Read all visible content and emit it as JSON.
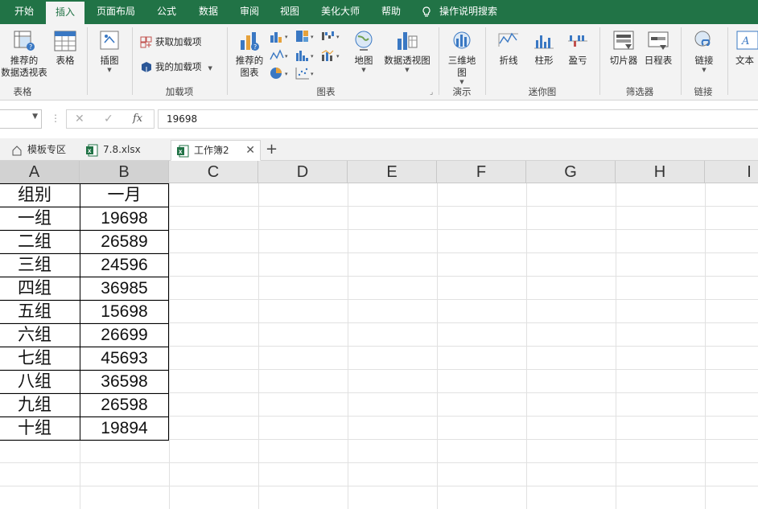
{
  "ribbon_tabs": [
    {
      "label": "开始"
    },
    {
      "label": "插入"
    },
    {
      "label": "页面布局"
    },
    {
      "label": "公式"
    },
    {
      "label": "数据"
    },
    {
      "label": "审阅"
    },
    {
      "label": "视图"
    },
    {
      "label": "美化大师"
    },
    {
      "label": "帮助"
    }
  ],
  "tell_me": "操作说明搜索",
  "ribbon": {
    "groups": {
      "tables": "表格",
      "addins": "加载项",
      "charts": "图表",
      "tours": "演示",
      "sparklines": "迷你图",
      "filters": "筛选器",
      "links": "链接"
    },
    "buttons": {
      "recommended_pivot_1": "推荐的",
      "recommended_pivot_2": "数据透视表",
      "table": "表格",
      "illustrations": "插图",
      "get_addins": "获取加载项",
      "my_addins": "我的加载项",
      "recommended_charts_1": "推荐的",
      "recommended_charts_2": "图表",
      "maps": "地图",
      "pivot_chart": "数据透视图",
      "map3d_1": "三维地",
      "map3d_2": "图",
      "line": "折线",
      "column": "柱形",
      "winloss": "盈亏",
      "slicer": "切片器",
      "timeline": "日程表",
      "link": "链接",
      "text": "文本"
    }
  },
  "formula_bar": {
    "value": "19698",
    "fx": "fx"
  },
  "doc_tabs": [
    {
      "label": "模板专区"
    },
    {
      "label": "7.8.xlsx"
    },
    {
      "label": "工作簿2"
    }
  ],
  "columns": [
    "A",
    "B",
    "C",
    "D",
    "E",
    "F",
    "G",
    "H",
    "I"
  ],
  "table": {
    "headers": [
      "组别",
      "一月"
    ],
    "rows": [
      {
        "group": "一组",
        "jan": "19698"
      },
      {
        "group": "二组",
        "jan": "26589"
      },
      {
        "group": "三组",
        "jan": "24596"
      },
      {
        "group": "四组",
        "jan": "36985"
      },
      {
        "group": "五组",
        "jan": "15698"
      },
      {
        "group": "六组",
        "jan": "26699"
      },
      {
        "group": "七组",
        "jan": "45693"
      },
      {
        "group": "八组",
        "jan": "36598"
      },
      {
        "group": "九组",
        "jan": "26598"
      },
      {
        "group": "十组",
        "jan": "19894"
      }
    ]
  },
  "colors": {
    "excel_green": "#217346",
    "ribbon_bg": "#f3f3f3"
  }
}
